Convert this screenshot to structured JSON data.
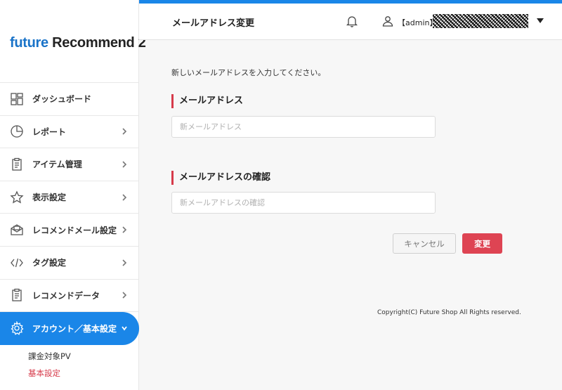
{
  "app": {
    "logo_part1": "future",
    "logo_part2": "Recommend 2"
  },
  "header": {
    "title": "メールアドレス変更",
    "user_label": "【admin】"
  },
  "sidebar": {
    "items": [
      {
        "label": "ダッシュボード",
        "icon": "dashboard-icon"
      },
      {
        "label": "レポート",
        "icon": "pie-chart-icon"
      },
      {
        "label": "アイテム管理",
        "icon": "clipboard-icon"
      },
      {
        "label": "表示設定",
        "icon": "star-icon"
      },
      {
        "label": "レコメンドメール設定",
        "icon": "mail-icon"
      },
      {
        "label": "タグ設定",
        "icon": "code-icon"
      },
      {
        "label": "レコメンドデータ",
        "icon": "clipboard-icon"
      },
      {
        "label": "アカウント／基本設定",
        "icon": "gear-icon"
      }
    ],
    "sub_items": [
      {
        "label": "課金対象PV"
      },
      {
        "label": "基本設定"
      }
    ]
  },
  "main": {
    "intro": "新しいメールアドレスを入力してください。",
    "email_label": "メールアドレス",
    "email_placeholder": "新メールアドレス",
    "confirm_label": "メールアドレスの確認",
    "confirm_placeholder": "新メールアドレスの確認",
    "cancel_label": "キャンセル",
    "submit_label": "変更"
  },
  "footer": {
    "copyright": "Copyright(C) Future Shop All Rights reserved."
  },
  "colors": {
    "accent": "#1a86e8",
    "danger": "#de4453",
    "brand": "#1a73c8"
  }
}
